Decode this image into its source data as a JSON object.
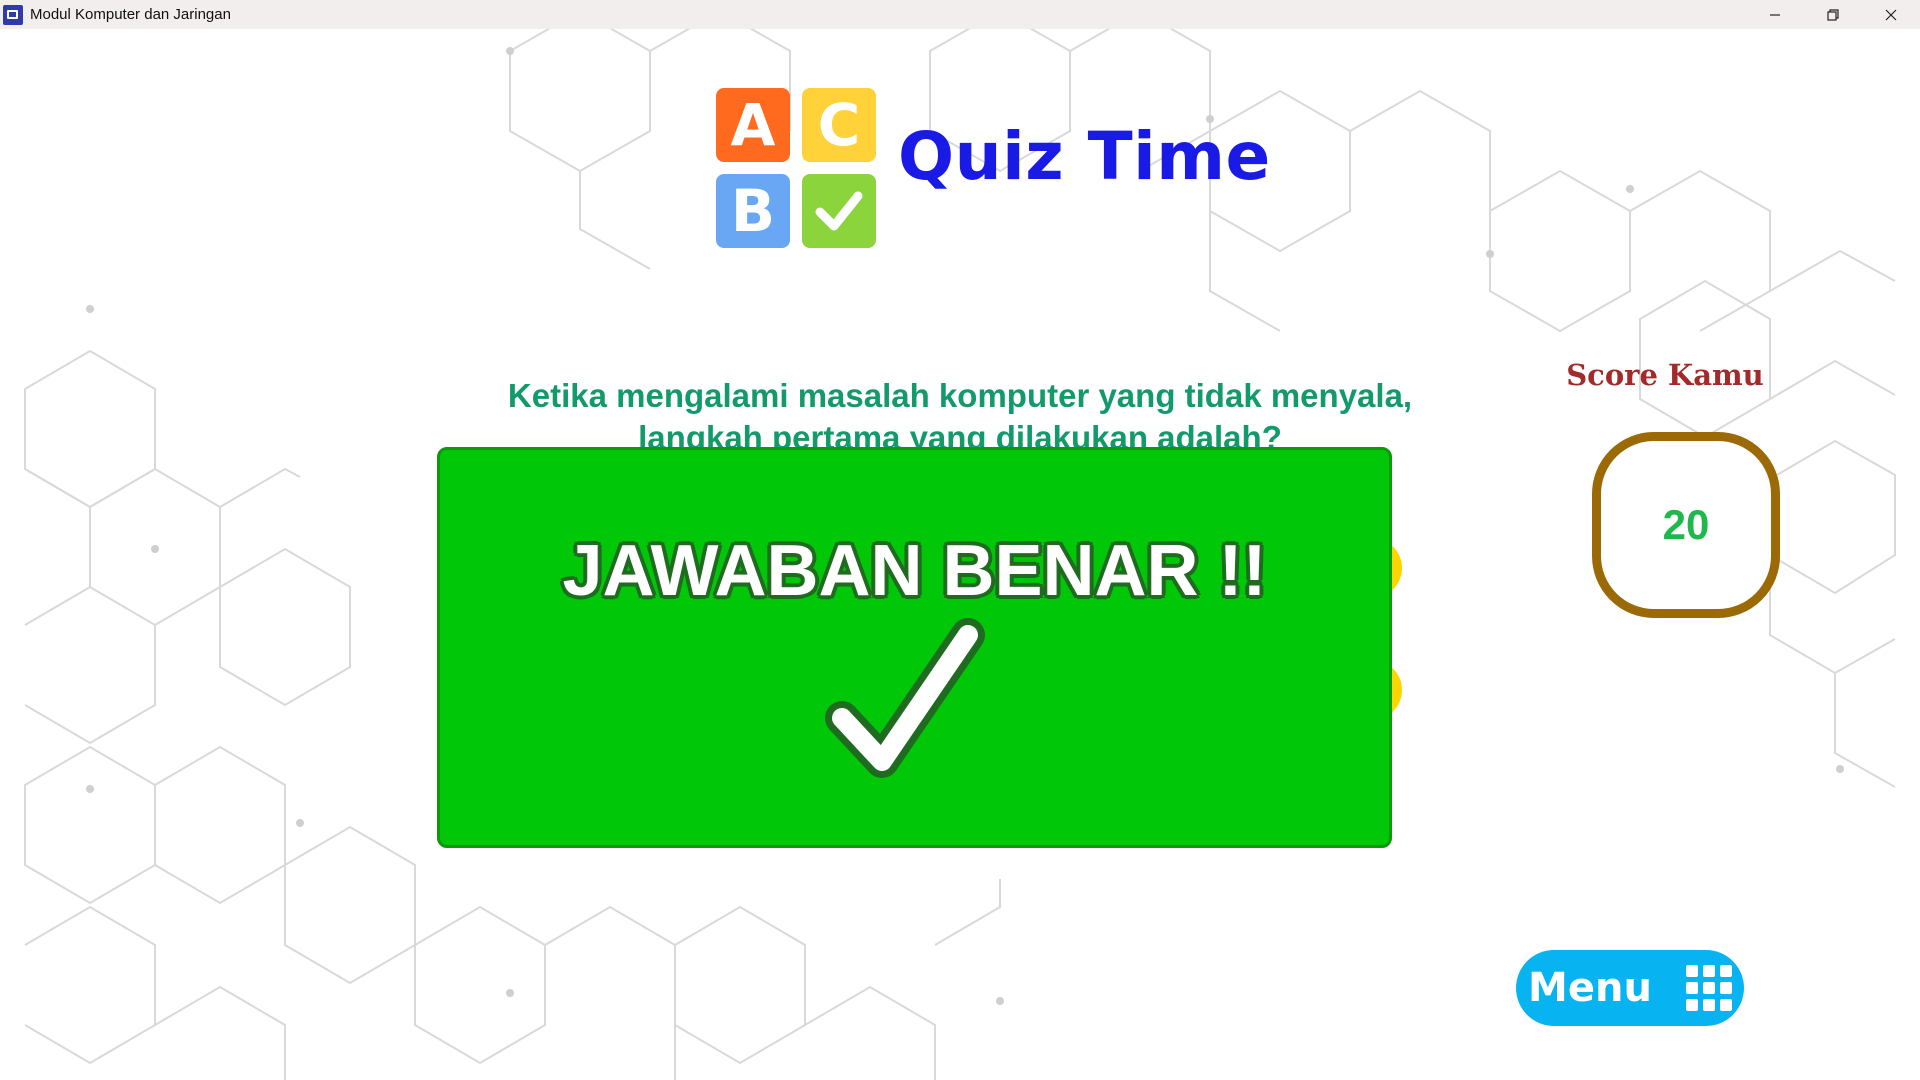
{
  "window": {
    "title": "Modul Komputer dan Jaringan",
    "controls": [
      "minimize-icon",
      "restore-icon",
      "close-icon"
    ]
  },
  "header": {
    "logo_tiles": [
      "A",
      "C",
      "B"
    ],
    "title": "Quiz Time"
  },
  "quiz": {
    "question": "Ketika mengalami masalah komputer yang tidak menyala, langkah pertama yang dilakukan adalah?"
  },
  "score": {
    "label": "Score Kamu",
    "value": "20"
  },
  "feedback": {
    "message": "JAWABAN BENAR !!",
    "icon": "checkmark-icon"
  },
  "menu": {
    "label": "Menu",
    "icon": "grid-menu-icon"
  },
  "colors": {
    "title_blue": "#1a1ae6",
    "question_green": "#139a6b",
    "overlay_green": "#00c808",
    "score_border": "#9b6a06",
    "score_value": "#1fb84a",
    "menu_blue": "#08b3f2"
  }
}
